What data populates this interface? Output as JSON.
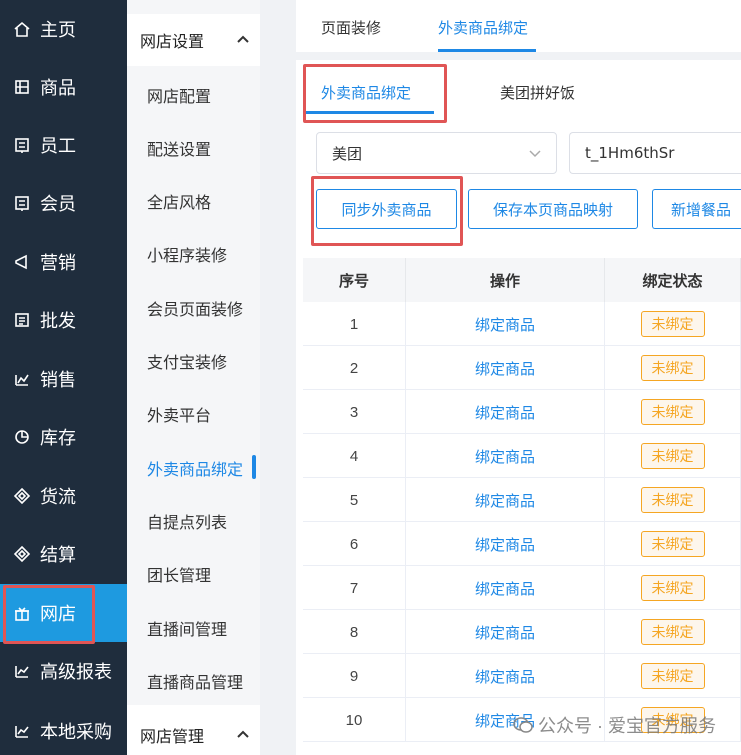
{
  "nav": {
    "items": [
      {
        "label": "主页",
        "icon": "home-icon"
      },
      {
        "label": "商品",
        "icon": "product-icon"
      },
      {
        "label": "员工",
        "icon": "staff-icon"
      },
      {
        "label": "会员",
        "icon": "member-icon"
      },
      {
        "label": "营销",
        "icon": "marketing-icon"
      },
      {
        "label": "批发",
        "icon": "wholesale-icon"
      },
      {
        "label": "销售",
        "icon": "sales-icon"
      },
      {
        "label": "库存",
        "icon": "inventory-icon"
      },
      {
        "label": "货流",
        "icon": "logistics-icon"
      },
      {
        "label": "结算",
        "icon": "settlement-icon"
      },
      {
        "label": "网店",
        "icon": "shop-icon"
      },
      {
        "label": "高级报表",
        "icon": "report-icon"
      },
      {
        "label": "本地采购",
        "icon": "purchase-icon"
      }
    ],
    "active_index": 10
  },
  "submenu": {
    "group1_title": "网店设置",
    "items": [
      "网店配置",
      "配送设置",
      "全店风格",
      "小程序装修",
      "会员页面装修",
      "支付宝装修",
      "外卖平台",
      "外卖商品绑定",
      "自提点列表",
      "团长管理",
      "直播间管理",
      "直播商品管理"
    ],
    "active_index": 7,
    "group2_title": "网店管理"
  },
  "tabs": {
    "items": [
      "页面装修",
      "外卖商品绑定"
    ],
    "active_index": 1
  },
  "subtabs": {
    "items": [
      "外卖商品绑定",
      "美团拼好饭"
    ],
    "active_index": 0
  },
  "filters": {
    "platform_value": "美团",
    "store_value": "t_1Hm6thSr"
  },
  "buttons": {
    "sync": "同步外卖商品",
    "save_mapping": "保存本页商品映射",
    "add_meal": "新增餐品"
  },
  "table": {
    "headers": [
      "序号",
      "操作",
      "绑定状态"
    ],
    "rows": [
      {
        "no": "1",
        "action": "绑定商品",
        "status": "未绑定"
      },
      {
        "no": "2",
        "action": "绑定商品",
        "status": "未绑定"
      },
      {
        "no": "3",
        "action": "绑定商品",
        "status": "未绑定"
      },
      {
        "no": "4",
        "action": "绑定商品",
        "status": "未绑定"
      },
      {
        "no": "5",
        "action": "绑定商品",
        "status": "未绑定"
      },
      {
        "no": "6",
        "action": "绑定商品",
        "status": "未绑定"
      },
      {
        "no": "7",
        "action": "绑定商品",
        "status": "未绑定"
      },
      {
        "no": "8",
        "action": "绑定商品",
        "status": "未绑定"
      },
      {
        "no": "9",
        "action": "绑定商品",
        "status": "未绑定"
      },
      {
        "no": "10",
        "action": "绑定商品",
        "status": "未绑定"
      }
    ]
  },
  "watermark": "公众号 · 爱宝官方服务",
  "colors": {
    "nav_bg": "#1f2d3d",
    "nav_active": "#1e9ae0",
    "accent": "#1e88e5",
    "highlight_box": "#e05555",
    "badge": "#f5a623"
  }
}
